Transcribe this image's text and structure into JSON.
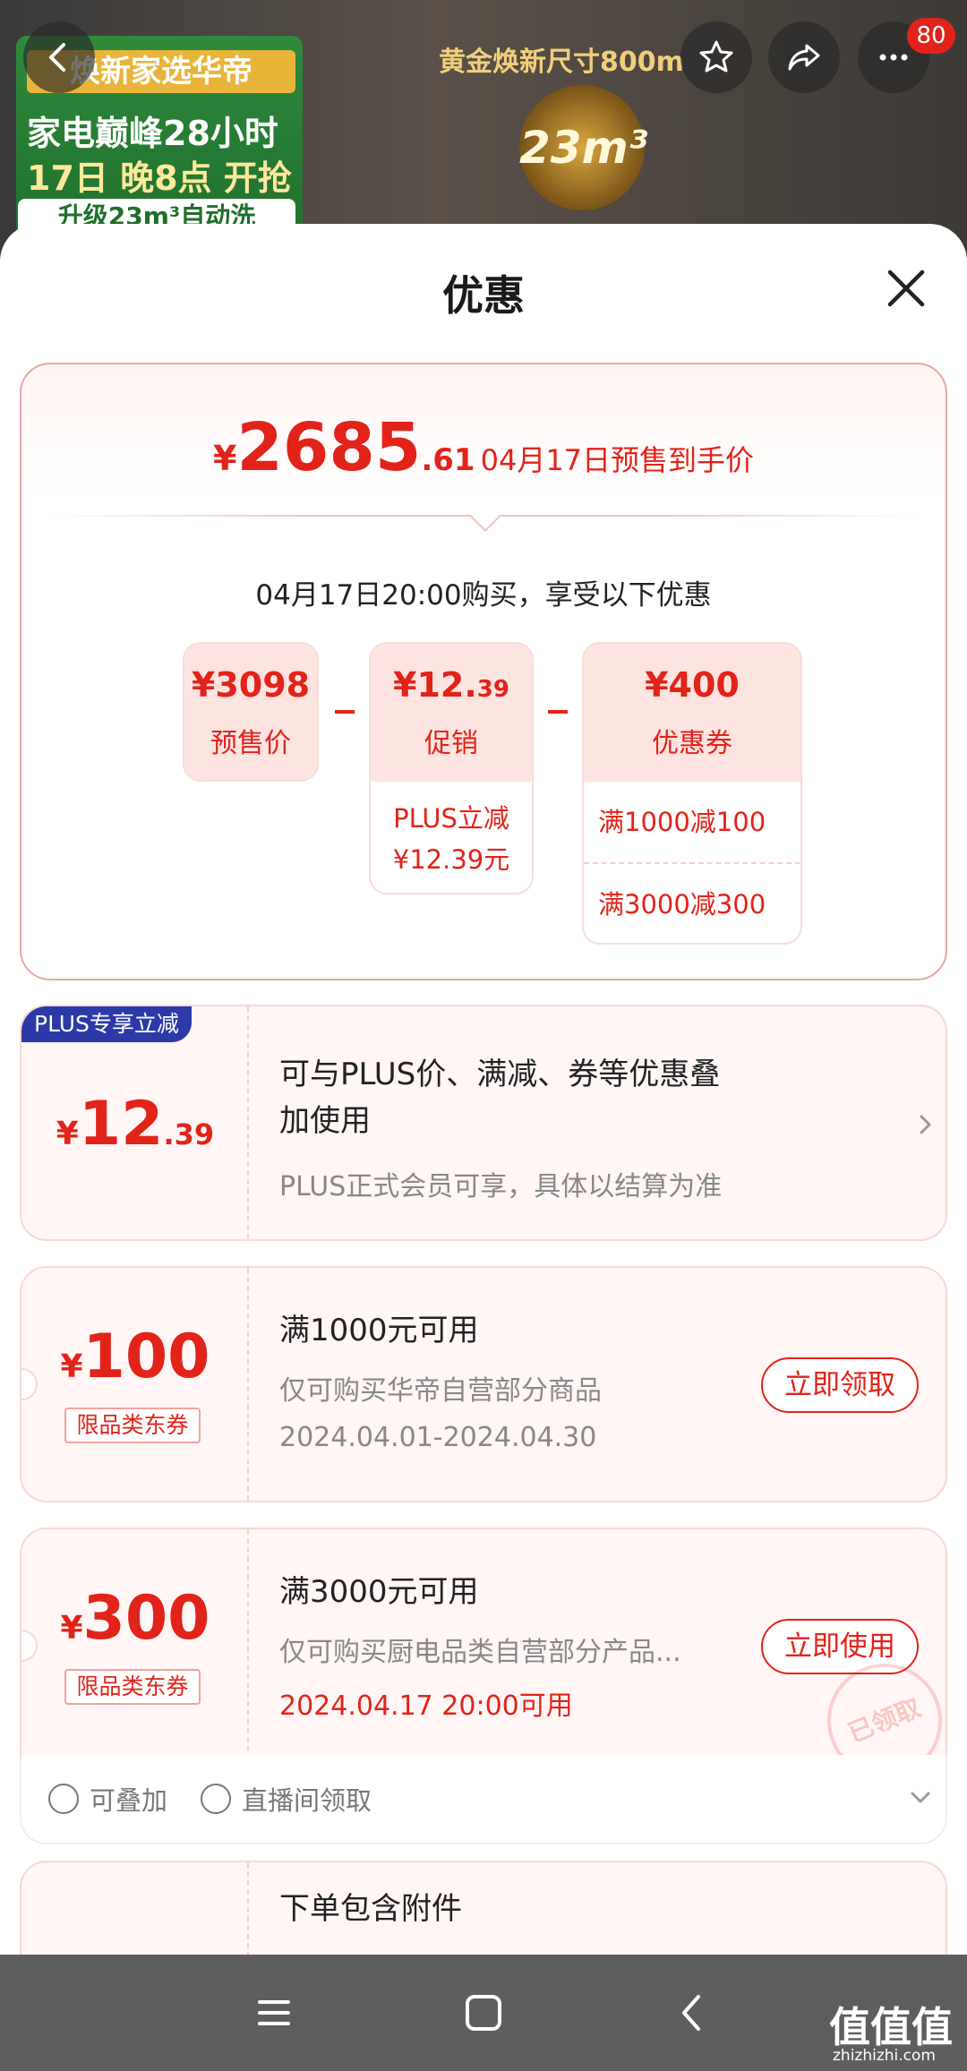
{
  "banner": {
    "promo_head": "焕新家选华帝",
    "promo_line1": "家电巅峰28小时",
    "promo_line2": "17日 晚8点 开抢",
    "promo_line3": "升级23m³自动洗",
    "gold_title": "黄金焕新尺寸800m",
    "badge_text": "23m³"
  },
  "header": {
    "notification_count": "80",
    "icons": [
      "back-icon",
      "star-icon",
      "share-icon",
      "more-icon"
    ]
  },
  "sheet": {
    "title": "优惠"
  },
  "summary": {
    "currency": "¥",
    "final_int": "2685",
    "final_dec": ".61",
    "final_label": "04月17日预售到手价",
    "buy_note": "04月17日20:00购买，享受以下优惠",
    "presale": {
      "value": "¥3098",
      "label": "预售价"
    },
    "promo": {
      "value_int": "¥12.",
      "value_dec": "39",
      "label": "促销",
      "sub_line1": "PLUS立减",
      "sub_line2": "¥12.39元"
    },
    "coupon": {
      "value": "¥400",
      "label": "优惠券",
      "lines": [
        "满1000减100",
        "满3000减300"
      ]
    }
  },
  "coupons": [
    {
      "flag": "PLUS专享立减",
      "currency": "¥",
      "amount": "12",
      "amount_dec": ".39",
      "title": "可与PLUS价、满减、券等优惠叠加使用",
      "title_line1": "可与PLUS价、满减、券等优惠叠",
      "title_line2": "加使用",
      "desc": "PLUS正式会员可享，具体以结算为准"
    },
    {
      "currency": "¥",
      "amount": "100",
      "tag": "限品类东券",
      "title": "满1000元可用",
      "desc": "仅可购买华帝自营部分商品",
      "date": "2024.04.01-2024.04.30",
      "action": "立即领取"
    },
    {
      "currency": "¥",
      "amount": "300",
      "tag": "限品类东券",
      "title": "满3000元可用",
      "desc": "仅可购买厨电品类自营部分产品...",
      "date": "2024.04.17 20:00可用",
      "action": "立即使用",
      "stamp": "已领取",
      "features": [
        "可叠加",
        "直播间领取"
      ]
    },
    {
      "title": "下单包含附件"
    }
  ],
  "watermark": {
    "logo": "值值值",
    "url": "zhizhizhi.com"
  },
  "colors": {
    "accent": "#e2231a",
    "plus_blue": "#2b3aa8",
    "card_bg": "#fff6f5"
  }
}
